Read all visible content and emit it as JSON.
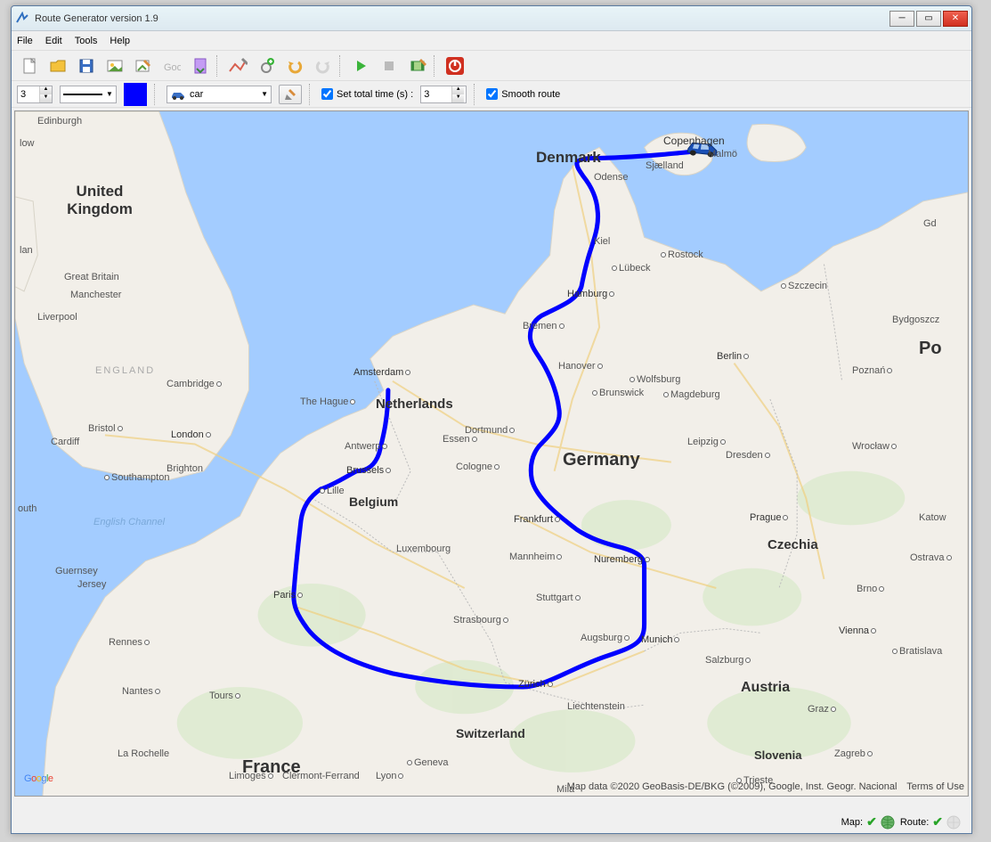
{
  "window": {
    "title": "Route Generator version 1.9"
  },
  "menubar": {
    "file": "File",
    "edit": "Edit",
    "tools": "Tools",
    "help": "Help"
  },
  "toolbar2": {
    "width_value": "3",
    "color": "#0000ff",
    "vehicle_label": "car",
    "set_total_time_label": "Set total time (s) :",
    "set_total_time_checked": true,
    "total_time_value": "3",
    "smooth_label": "Smooth route",
    "smooth_checked": true
  },
  "statusbar": {
    "map_label": "Map:",
    "route_label": "Route:"
  },
  "map": {
    "attribution": "Map data ©2020 GeoBasis-DE/BKG (©2009), Google, Inst. Geogr. Nacional",
    "terms": "Terms of Use",
    "labels": {
      "uk": "United\nKingdom",
      "england": "ENGLAND",
      "gb": "Great Britain",
      "edinburgh": "Edinburgh",
      "manchester": "Manchester",
      "liverpool": "Liverpool",
      "cardiff": "Cardiff",
      "bristol": "Bristol",
      "london": "London",
      "brighton": "Brighton",
      "southampton": "Southampton",
      "cambridge": "Cambridge",
      "denmark": "Denmark",
      "copenhagen": "Copenhagen",
      "malmo": "Malmö",
      "odense": "Odense",
      "sjaelland": "Sjælland",
      "netherlands": "Netherlands",
      "amsterdam": "Amsterdam",
      "hague": "The Hague",
      "antwerp": "Antwerp",
      "brussels": "Brussels",
      "belgium": "Belgium",
      "lille": "Lille",
      "luxembourg": "Luxembourg",
      "france": "France",
      "paris": "Paris",
      "rennes": "Rennes",
      "nantes": "Nantes",
      "tours": "Tours",
      "larochelle": "La Rochelle",
      "limoges": "Limoges",
      "clermont": "Clermont-Ferrand",
      "lyon": "Lyon",
      "geneva": "Geneva",
      "switzerland": "Switzerland",
      "zurich": "Zürich",
      "liechtenstein": "Liechtenstein",
      "mila": "Mila",
      "strasbourg": "Strasbourg",
      "mannheim": "Mannheim",
      "frankfurt": "Frankfurt",
      "stuttgart": "Stuttgart",
      "augsburg": "Augsburg",
      "munich": "Munich",
      "nuremberg": "Nuremberg",
      "germany": "Germany",
      "cologne": "Cologne",
      "essen": "Essen",
      "dortmund": "Dortmund",
      "hanover": "Hanover",
      "brunswick": "Brunswick",
      "wolfsburg": "Wolfsburg",
      "magdeburg": "Magdeburg",
      "bremen": "Bremen",
      "hamburg": "Hamburg",
      "lubeck": "Lübeck",
      "kiel": "Kiel",
      "rostock": "Rostock",
      "szczecin": "Szczecin",
      "berlin": "Berlin",
      "leipzig": "Leipzig",
      "dresden": "Dresden",
      "prague": "Prague",
      "czechia": "Czechia",
      "brno": "Brno",
      "austria": "Austria",
      "salzburg": "Salzburg",
      "vienna": "Vienna",
      "bratislava": "Bratislava",
      "graz": "Graz",
      "slovenia": "Slovenia",
      "zagreb": "Zagreb",
      "trieste": "Trieste",
      "po": "Po",
      "gd": "Gd",
      "bydgoszcz": "Bydgoszcz",
      "poznan": "Poznań",
      "wroclaw": "Wrocław",
      "katow": "Katow",
      "ostrava": "Ostrava",
      "guernsey": "Guernsey",
      "jersey": "Jersey",
      "engchannel": "English Channel",
      "low": "low",
      "lan": "lan",
      "outh": "outh"
    }
  }
}
